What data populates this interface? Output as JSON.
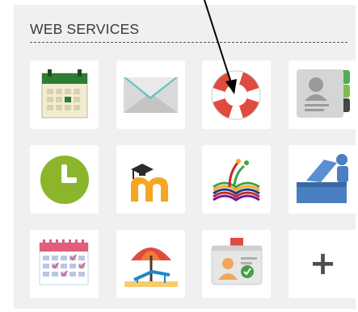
{
  "section": {
    "title": "WEB SERVICES"
  },
  "tiles": [
    {
      "icon": "calendar-icon"
    },
    {
      "icon": "mail-envelope-icon"
    },
    {
      "icon": "lifebuoy-help-icon"
    },
    {
      "icon": "contacts-card-icon"
    },
    {
      "icon": "clock-icon"
    },
    {
      "icon": "moodle-graduation-cap-icon"
    },
    {
      "icon": "open-book-icon"
    },
    {
      "icon": "presenter-desk-icon"
    },
    {
      "icon": "calendar-schedule-icon"
    },
    {
      "icon": "beach-umbrella-icon"
    },
    {
      "icon": "id-badge-icon"
    },
    {
      "icon": "plus-icon",
      "label": "+"
    }
  ],
  "colors": {
    "panel_bg": "#f0f0f0",
    "tile_bg": "#ffffff",
    "calendar_green": "#2e7d32",
    "clock_green": "#8bb52a",
    "lifebuoy_red": "#e04b3f",
    "moodle_orange": "#f5a623"
  }
}
